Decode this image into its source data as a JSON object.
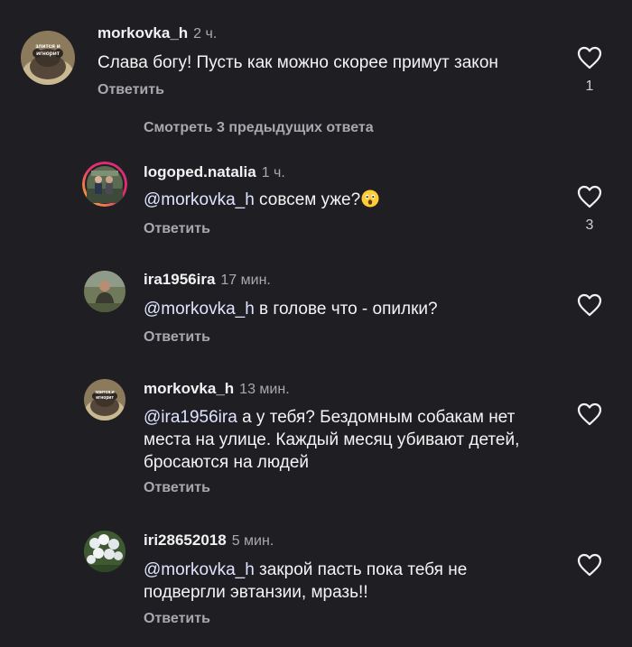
{
  "comments": [
    {
      "username": "morkovka_h",
      "time": "2 ч.",
      "text": "Слава богу! Пусть как можно скорее примут закон",
      "reply_label": "Ответить",
      "likes": "1",
      "avatar_text": "злится и игнорит"
    },
    {
      "username": "logoped.natalia",
      "time": "1 ч.",
      "mention": "@morkovka_h",
      "text": " совсем уже?",
      "emoji": "astonished-face-emoji",
      "reply_label": "Ответить",
      "likes": "3"
    },
    {
      "username": "ira1956ira",
      "time": "17 мин.",
      "mention": "@morkovka_h",
      "text": " в голове что - опилки?",
      "reply_label": "Ответить"
    },
    {
      "username": "morkovka_h",
      "time": "13 мин.",
      "mention": "@ira1956ira",
      "text": " а у тебя? Бездомным собакам нет места на улице. Каждый месяц убивают детей, бросаются на людей",
      "reply_label": "Ответить",
      "avatar_text": "злится и игнорит"
    },
    {
      "username": "iri28652018",
      "time": "5 мин.",
      "mention": "@morkovka_h",
      "text": "  закрой пасть пока тебя не подвергли эвтанзии, мразь!!",
      "reply_label": "Ответить"
    }
  ],
  "view_previous": "Смотреть 3 предыдущих ответа",
  "colors": {
    "background": "#1f1f23",
    "secondary_text": "#a8a8ae",
    "primary_text": "#f2f2f2",
    "story_ring_start": "#f9c22e",
    "story_ring_end": "#d62976"
  },
  "icons": {
    "like": "heart-outline-icon"
  }
}
